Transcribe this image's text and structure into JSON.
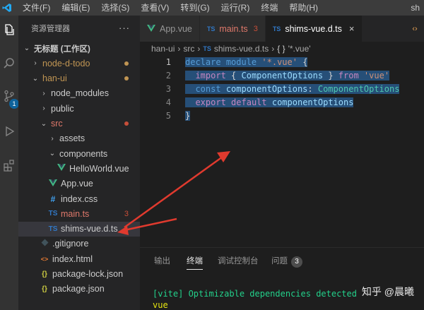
{
  "menubar": {
    "items": [
      "文件(F)",
      "编辑(E)",
      "选择(S)",
      "查看(V)",
      "转到(G)",
      "运行(R)",
      "终端",
      "帮助(H)"
    ],
    "window_title": "sh"
  },
  "activitybar": {
    "icons": [
      "explorer-icon",
      "search-icon",
      "source-control-icon",
      "run-debug-icon",
      "extensions-icon"
    ],
    "source_control_badge": "1"
  },
  "sidebar": {
    "header": "资源管理器",
    "more": "···",
    "tree": [
      {
        "label": "无标题 (工作区)",
        "indent": 0,
        "chevron": "⌄",
        "kind": "workspace"
      },
      {
        "label": "node-d-todo",
        "indent": 1,
        "chevron": "›",
        "kind": "folder",
        "status_color": "#c09553"
      },
      {
        "label": "han-ui",
        "indent": 1,
        "chevron": "⌄",
        "kind": "folder",
        "status_color": "#c09553"
      },
      {
        "label": "node_modules",
        "indent": 2,
        "chevron": "›",
        "kind": "folder"
      },
      {
        "label": "public",
        "indent": 2,
        "chevron": "›",
        "kind": "folder"
      },
      {
        "label": "src",
        "indent": 2,
        "chevron": "⌄",
        "kind": "folder-error",
        "status_color": "#c74e39"
      },
      {
        "label": "assets",
        "indent": 3,
        "chevron": "›",
        "kind": "folder"
      },
      {
        "label": "components",
        "indent": 3,
        "chevron": "⌄",
        "kind": "folder"
      },
      {
        "label": "HelloWorld.vue",
        "indent": 4,
        "kind": "vue"
      },
      {
        "label": "App.vue",
        "indent": 3,
        "kind": "vue"
      },
      {
        "label": "index.css",
        "indent": 3,
        "kind": "css"
      },
      {
        "label": "main.ts",
        "indent": 3,
        "kind": "ts-error",
        "errors": "3"
      },
      {
        "label": "shims-vue.d.ts",
        "indent": 3,
        "kind": "ts",
        "selected": true
      },
      {
        "label": ".gitignore",
        "indent": 2,
        "kind": "git"
      },
      {
        "label": "index.html",
        "indent": 2,
        "kind": "html"
      },
      {
        "label": "package-lock.json",
        "indent": 2,
        "kind": "json"
      },
      {
        "label": "package.json",
        "indent": 2,
        "kind": "json"
      }
    ]
  },
  "tabs": [
    {
      "label": "App.vue",
      "icon": "vue-icon",
      "active": false
    },
    {
      "label": "main.ts",
      "icon": "typescript-icon",
      "icon_text": "TS",
      "active": false,
      "errors": "3"
    },
    {
      "label": "shims-vue.d.ts",
      "icon": "typescript-icon",
      "icon_text": "TS",
      "active": true,
      "close": "×"
    }
  ],
  "tab_actions_icon": "‹›",
  "breadcrumb": {
    "parts": [
      "han-ui",
      "src",
      "shims-vue.d.ts",
      "'*.vue'"
    ],
    "ts_icon": "TS",
    "module_icon": "{ }"
  },
  "editor": {
    "line_numbers": [
      "1",
      "2",
      "3",
      "4",
      "5"
    ],
    "current_line": "1",
    "lines": [
      [
        {
          "t": "declare",
          "c": "kw"
        },
        {
          "t": " ",
          "c": "pl"
        },
        {
          "t": "module",
          "c": "kw"
        },
        {
          "t": " ",
          "c": "pl"
        },
        {
          "t": "'*.vue'",
          "c": "str"
        },
        {
          "t": " {",
          "c": "pl"
        }
      ],
      [
        {
          "t": "  ",
          "c": "pl"
        },
        {
          "t": "import",
          "c": "kw2"
        },
        {
          "t": " { ",
          "c": "pl"
        },
        {
          "t": "ComponentOptions",
          "c": "vr"
        },
        {
          "t": " } ",
          "c": "pl"
        },
        {
          "t": "from",
          "c": "kw2"
        },
        {
          "t": " ",
          "c": "pl"
        },
        {
          "t": "'vue'",
          "c": "str"
        }
      ],
      [
        {
          "t": "  ",
          "c": "pl"
        },
        {
          "t": "const",
          "c": "kw"
        },
        {
          "t": " ",
          "c": "pl"
        },
        {
          "t": "componentOptions",
          "c": "vr"
        },
        {
          "t": ": ",
          "c": "pl"
        },
        {
          "t": "ComponentOptions",
          "c": "ty"
        }
      ],
      [
        {
          "t": "  ",
          "c": "pl"
        },
        {
          "t": "export",
          "c": "kw2"
        },
        {
          "t": " ",
          "c": "pl"
        },
        {
          "t": "default",
          "c": "kw2"
        },
        {
          "t": " ",
          "c": "pl"
        },
        {
          "t": "componentOptions",
          "c": "vr"
        }
      ],
      [
        {
          "t": "}",
          "c": "pl"
        }
      ]
    ]
  },
  "panel": {
    "tabs": [
      "输出",
      "终端",
      "调试控制台",
      "问题"
    ],
    "active_tab": "终端",
    "problems_count": "3",
    "terminal_lines": [
      "[vite] Optimizable dependencies detected",
      "vue"
    ]
  },
  "watermark": "知乎 @晨曦",
  "colors": {
    "accent": "#007acc",
    "selection": "#264f78",
    "error": "#c74e39",
    "arrow": "#e03a2e",
    "terminal_green": "#23d18b"
  }
}
